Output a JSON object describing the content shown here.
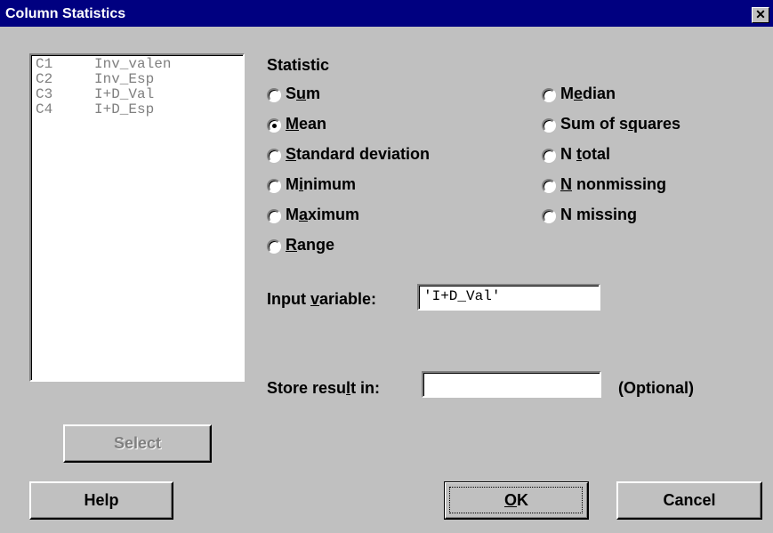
{
  "window": {
    "title": "Column Statistics",
    "close_glyph": "✕"
  },
  "variables": [
    {
      "id": "C1",
      "name": "Inv_valen"
    },
    {
      "id": "C2",
      "name": "Inv_Esp"
    },
    {
      "id": "C3",
      "name": "I+D_Val"
    },
    {
      "id": "C4",
      "name": "I+D_Esp"
    }
  ],
  "statistic": {
    "heading": "Statistic",
    "selected": "Mean",
    "options_left": [
      {
        "label": "Sum",
        "mnemonic_pre": "S",
        "mnemonic": "u",
        "mnemonic_post": "m",
        "checked": false
      },
      {
        "label": "Mean",
        "mnemonic_pre": "",
        "mnemonic": "M",
        "mnemonic_post": "ean",
        "checked": true
      },
      {
        "label": "Standard deviation",
        "mnemonic_pre": "",
        "mnemonic": "S",
        "mnemonic_post": "tandard deviation",
        "checked": false
      },
      {
        "label": "Minimum",
        "mnemonic_pre": "M",
        "mnemonic": "i",
        "mnemonic_post": "nimum",
        "checked": false
      },
      {
        "label": "Maximum",
        "mnemonic_pre": "M",
        "mnemonic": "a",
        "mnemonic_post": "ximum",
        "checked": false
      },
      {
        "label": "Range",
        "mnemonic_pre": "",
        "mnemonic": "R",
        "mnemonic_post": "ange",
        "checked": false
      }
    ],
    "options_right": [
      {
        "label": "Median",
        "mnemonic_pre": "M",
        "mnemonic": "e",
        "mnemonic_post": "dian",
        "checked": false
      },
      {
        "label": "Sum of squares",
        "mnemonic_pre": "Sum of s",
        "mnemonic": "q",
        "mnemonic_post": "uares",
        "checked": false
      },
      {
        "label": "N total",
        "mnemonic_pre": "N ",
        "mnemonic": "t",
        "mnemonic_post": "otal",
        "checked": false
      },
      {
        "label": "N nonmissing",
        "mnemonic_pre": "",
        "mnemonic": "N",
        "mnemonic_post": " nonmissing",
        "checked": false
      },
      {
        "label": "N missing",
        "mnemonic_pre": "N missin",
        "mnemonic": "g",
        "mnemonic_post": "",
        "checked": false
      }
    ]
  },
  "input_variable": {
    "label_pre": "Input ",
    "label_mnemonic": "v",
    "label_post": "ariable:",
    "value": "'I+D_Val'"
  },
  "store_result": {
    "label_pre": "Store resu",
    "label_mnemonic": "l",
    "label_post": "t in:",
    "value": "",
    "optional_note": "(Optional)"
  },
  "buttons": {
    "select": "Select",
    "help": "Help",
    "ok_mnemonic": "O",
    "ok_post": "K",
    "cancel": "Cancel"
  }
}
